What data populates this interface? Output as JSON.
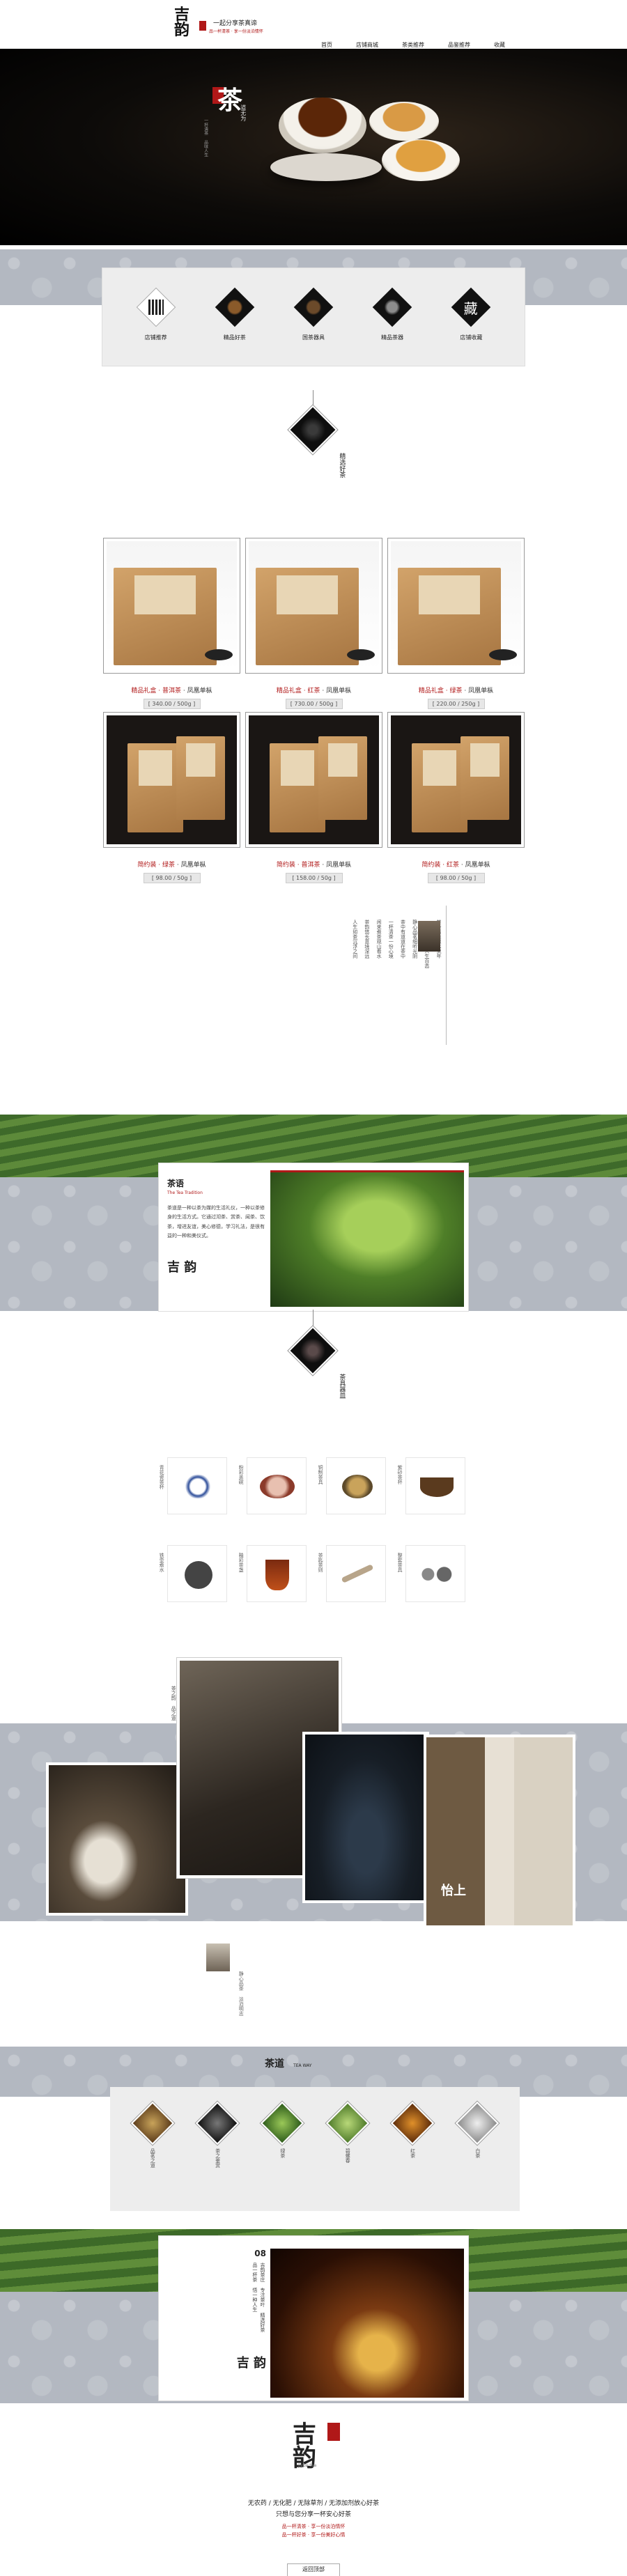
{
  "header": {
    "logo_text": "吉 韵",
    "slogan_line1": "一起分享茶真谛",
    "slogan_line2": "品一杯清茶 · 享一份淡泊情怀",
    "nav": [
      "首页",
      "店铺商城",
      "茶类推荐",
      "品鉴推荐",
      "收藏"
    ]
  },
  "hero": {
    "title": "茶",
    "subtitle": "道无为",
    "caption": "一杯清茶 品味人生"
  },
  "categories": [
    {
      "label": "店铺推荐",
      "icon": "qr-code-icon"
    },
    {
      "label": "精品好茶",
      "icon": "tea-leaf-icon"
    },
    {
      "label": "国茶器具",
      "icon": "teapot-icon"
    },
    {
      "label": "精品茶器",
      "icon": "tea-set-icon"
    },
    {
      "label": "店铺收藏",
      "icon": "collect-icon"
    }
  ],
  "collect_char": "藏",
  "section_tea": {
    "title": "精选好茶"
  },
  "products": [
    {
      "title": "精品礼盒 · 普洱茶",
      "tag": "凤凰单枞",
      "price": "[ 340.00 / 500g ]"
    },
    {
      "title": "精品礼盒 · 红茶",
      "tag": "凤凰单枞",
      "price": "[ 730.00 / 500g ]"
    },
    {
      "title": "精品礼盒 · 绿茶",
      "tag": "凤凰单枞",
      "price": "[ 220.00 / 250g ]"
    },
    {
      "title": "简约装 · 绿茶",
      "tag": "凤凰单枞",
      "price": "[ 98.00 / 50g ]"
    },
    {
      "title": "简约装 · 普洱茶",
      "tag": "凤凰单枞",
      "price": "[ 158.00 / 50g ]"
    },
    {
      "title": "简约装 · 红茶",
      "tag": "凤凰单枞",
      "price": "[ 98.00 / 50g ]"
    }
  ],
  "poem": [
    "茶香清淡似水流年",
    "一壶好茶品味人生百态",
    "静心品茗细听光阴",
    "茶中有道道在茶中",
    "一杯清茶一份心境",
    "闲来煮茶观山看水",
    "茶韵悠长意境深远",
    "人生如茶沉浮之间"
  ],
  "tea_story": {
    "title": "茶语",
    "subtitle": "The Tea Tradition",
    "body": "茶道是一种以茶为媒的生活礼仪，一种以茶修身的生活方式。它通过沏茶、赏茶、闻茶、饮茶，增进友谊，美心修德，学习礼法，是很有益的一种和美仪式。"
  },
  "section_ware": {
    "title": "茶具器皿"
  },
  "wares": [
    {
      "label": "青花瓷茶杯"
    },
    {
      "label": "粉彩盖碗"
    },
    {
      "label": "铜制茶具"
    },
    {
      "label": "紫砂茶杯"
    },
    {
      "label": "铁壶煮水"
    },
    {
      "label": "釉彩茶盏"
    },
    {
      "label": "茶匙茶则"
    },
    {
      "label": "整套茶具"
    }
  ],
  "gallery": {
    "label": "茶之韵 品之道",
    "calligraphy": "怡上",
    "note": "静心品茶 淡泊明志"
  },
  "tea_types": {
    "title": "茶道",
    "subtitle": "TEA WAY",
    "items": [
      "品茗之道",
      "茶之鉴赏",
      "绿茶",
      "碧螺春",
      "红茶",
      "白茶"
    ]
  },
  "about": {
    "number": "08",
    "body": "吉韵茶庄\n专注茶叶\n精选好茶\n品一杯茶\n悟一种人生"
  },
  "footer": {
    "logo_text": "吉 韵",
    "brand_en": "jiyun·tea",
    "motto1": "无农药 / 无化肥 / 无除草剂 / 无添加剂放心好茶",
    "motto2": "只想与您分享一杯安心好茶",
    "red1": "品一杯清茶 · 享一份淡泊情怀",
    "red2": "品一杯好茶 · 享一份美好心情",
    "back_top": "返回顶部"
  },
  "colors": {
    "accent": "#b01818",
    "band": "#b3b8c1",
    "dark": "#111111"
  }
}
